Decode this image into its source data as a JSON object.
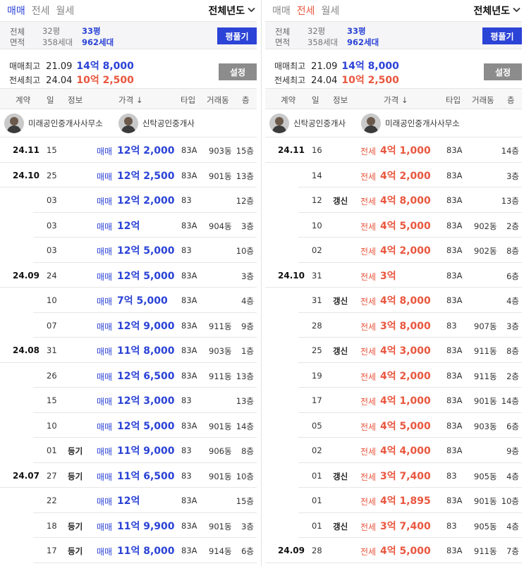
{
  "left": {
    "tabs": [
      {
        "label": "매매",
        "active": true
      },
      {
        "label": "전세",
        "active": false
      },
      {
        "label": "월세",
        "active": false
      }
    ],
    "year_filter": "전체년도",
    "summary": {
      "label_total": "전체",
      "label_area": "면적",
      "py1": "32평",
      "units1": "358세대",
      "py2": "33평",
      "units2": "962세대",
      "button": "평풀기"
    },
    "highs": {
      "sale_label": "매매최고",
      "sale_date": "21.09",
      "sale_price": "14억 8,000",
      "jeonse_label": "전세최고",
      "jeonse_date": "24.04",
      "jeonse_price": "10억 2,500",
      "button": "설정"
    },
    "headers": {
      "contract": "계약",
      "day": "일",
      "info": "정보",
      "price": "가격 ↓",
      "type": "타입",
      "bldg": "거래동",
      "floor": "층"
    },
    "agents": [
      "미래공인중개사사무소",
      "신탁공인중개사"
    ],
    "rows": [
      {
        "month": "24.11",
        "day": "15",
        "info": "",
        "kind": "매매",
        "price": "12억 2,000",
        "type": "83A",
        "bldg": "903동",
        "floor": "15층"
      },
      {
        "month": "24.10",
        "day": "25",
        "info": "",
        "kind": "매매",
        "price": "12억 2,500",
        "type": "83A",
        "bldg": "901동",
        "floor": "13층"
      },
      {
        "month": "",
        "day": "03",
        "info": "",
        "kind": "매매",
        "price": "12억 2,000",
        "type": "83",
        "bldg": "",
        "floor": "12층"
      },
      {
        "month": "",
        "day": "03",
        "info": "",
        "kind": "매매",
        "price": "12억",
        "type": "83A",
        "bldg": "904동",
        "floor": "3층"
      },
      {
        "month": "",
        "day": "03",
        "info": "",
        "kind": "매매",
        "price": "12억 5,000",
        "type": "83",
        "bldg": "",
        "floor": "10층"
      },
      {
        "month": "24.09",
        "day": "24",
        "info": "",
        "kind": "매매",
        "price": "12억 5,000",
        "type": "83A",
        "bldg": "",
        "floor": "3층"
      },
      {
        "month": "",
        "day": "10",
        "info": "",
        "kind": "매매",
        "price": "7억 5,000",
        "type": "83A",
        "bldg": "",
        "floor": "4층"
      },
      {
        "month": "",
        "day": "07",
        "info": "",
        "kind": "매매",
        "price": "12억 9,000",
        "type": "83A",
        "bldg": "911동",
        "floor": "9층"
      },
      {
        "month": "24.08",
        "day": "31",
        "info": "",
        "kind": "매매",
        "price": "11억 8,000",
        "type": "83A",
        "bldg": "903동",
        "floor": "1층"
      },
      {
        "month": "",
        "day": "26",
        "info": "",
        "kind": "매매",
        "price": "12억 6,500",
        "type": "83A",
        "bldg": "911동",
        "floor": "13층"
      },
      {
        "month": "",
        "day": "15",
        "info": "",
        "kind": "매매",
        "price": "12억 3,000",
        "type": "83",
        "bldg": "",
        "floor": "13층"
      },
      {
        "month": "",
        "day": "10",
        "info": "",
        "kind": "매매",
        "price": "12억 5,000",
        "type": "83A",
        "bldg": "901동",
        "floor": "14층"
      },
      {
        "month": "",
        "day": "01",
        "info": "등기",
        "kind": "매매",
        "price": "11억 9,000",
        "type": "83",
        "bldg": "906동",
        "floor": "8층"
      },
      {
        "month": "24.07",
        "day": "27",
        "info": "등기",
        "kind": "매매",
        "price": "11억 6,500",
        "type": "83",
        "bldg": "901동",
        "floor": "10층"
      },
      {
        "month": "",
        "day": "22",
        "info": "",
        "kind": "매매",
        "price": "12억",
        "type": "83A",
        "bldg": "",
        "floor": "15층"
      },
      {
        "month": "",
        "day": "18",
        "info": "등기",
        "kind": "매매",
        "price": "11억 9,900",
        "type": "83A",
        "bldg": "901동",
        "floor": "3층"
      },
      {
        "month": "",
        "day": "17",
        "info": "등기",
        "kind": "매매",
        "price": "11억 8,000",
        "type": "83A",
        "bldg": "914동",
        "floor": "6층"
      }
    ]
  },
  "right": {
    "tabs": [
      {
        "label": "매매",
        "active": false
      },
      {
        "label": "전세",
        "active": true
      },
      {
        "label": "월세",
        "active": false
      }
    ],
    "year_filter": "전체년도",
    "summary": {
      "label_total": "전체",
      "label_area": "면적",
      "py1": "32평",
      "units1": "358세대",
      "py2": "33평",
      "units2": "962세대",
      "button": "평풀기"
    },
    "highs": {
      "sale_label": "매매최고",
      "sale_date": "21.09",
      "sale_price": "14억 8,000",
      "jeonse_label": "전세최고",
      "jeonse_date": "24.04",
      "jeonse_price": "10억 2,500",
      "button": "설정"
    },
    "headers": {
      "contract": "계약",
      "day": "일",
      "info": "정보",
      "price": "가격 ↓",
      "type": "타입",
      "bldg": "거래동",
      "floor": "층"
    },
    "agents": [
      "신탁공인중개사",
      "미래공인중개사사무소"
    ],
    "rows": [
      {
        "month": "24.11",
        "day": "16",
        "info": "",
        "kind": "전세",
        "price": "4억 1,000",
        "type": "83A",
        "bldg": "",
        "floor": "14층"
      },
      {
        "month": "",
        "day": "14",
        "info": "",
        "kind": "전세",
        "price": "4억 2,000",
        "type": "83A",
        "bldg": "",
        "floor": "3층"
      },
      {
        "month": "",
        "day": "12",
        "info": "갱신",
        "kind": "전세",
        "price": "4억 8,000",
        "type": "83A",
        "bldg": "",
        "floor": "13층"
      },
      {
        "month": "",
        "day": "10",
        "info": "",
        "kind": "전세",
        "price": "4억 5,000",
        "type": "83A",
        "bldg": "902동",
        "floor": "2층"
      },
      {
        "month": "",
        "day": "02",
        "info": "",
        "kind": "전세",
        "price": "4억 2,000",
        "type": "83A",
        "bldg": "902동",
        "floor": "8층"
      },
      {
        "month": "24.10",
        "day": "31",
        "info": "",
        "kind": "전세",
        "price": "3억",
        "type": "83A",
        "bldg": "",
        "floor": "6층"
      },
      {
        "month": "",
        "day": "31",
        "info": "갱신",
        "kind": "전세",
        "price": "4억 8,000",
        "type": "83A",
        "bldg": "",
        "floor": "4층"
      },
      {
        "month": "",
        "day": "28",
        "info": "",
        "kind": "전세",
        "price": "3억 8,000",
        "type": "83",
        "bldg": "907동",
        "floor": "3층"
      },
      {
        "month": "",
        "day": "25",
        "info": "갱신",
        "kind": "전세",
        "price": "4억 3,000",
        "type": "83A",
        "bldg": "911동",
        "floor": "8층"
      },
      {
        "month": "",
        "day": "19",
        "info": "",
        "kind": "전세",
        "price": "4억 2,000",
        "type": "83A",
        "bldg": "911동",
        "floor": "2층"
      },
      {
        "month": "",
        "day": "17",
        "info": "",
        "kind": "전세",
        "price": "4억 1,000",
        "type": "83A",
        "bldg": "901동",
        "floor": "14층"
      },
      {
        "month": "",
        "day": "05",
        "info": "",
        "kind": "전세",
        "price": "4억 5,000",
        "type": "83A",
        "bldg": "903동",
        "floor": "6층"
      },
      {
        "month": "",
        "day": "02",
        "info": "",
        "kind": "전세",
        "price": "4억 4,000",
        "type": "83A",
        "bldg": "",
        "floor": "9층"
      },
      {
        "month": "",
        "day": "01",
        "info": "갱신",
        "kind": "전세",
        "price": "3억 7,400",
        "type": "83",
        "bldg": "905동",
        "floor": "4층"
      },
      {
        "month": "",
        "day": "01",
        "info": "",
        "kind": "전세",
        "price": "4억 1,895",
        "type": "83A",
        "bldg": "901동",
        "floor": "10층"
      },
      {
        "month": "",
        "day": "01",
        "info": "갱신",
        "kind": "전세",
        "price": "3억 7,400",
        "type": "83",
        "bldg": "905동",
        "floor": "4층"
      },
      {
        "month": "24.09",
        "day": "28",
        "info": "",
        "kind": "전세",
        "price": "4억 5,000",
        "type": "83A",
        "bldg": "911동",
        "floor": "7층"
      }
    ]
  }
}
